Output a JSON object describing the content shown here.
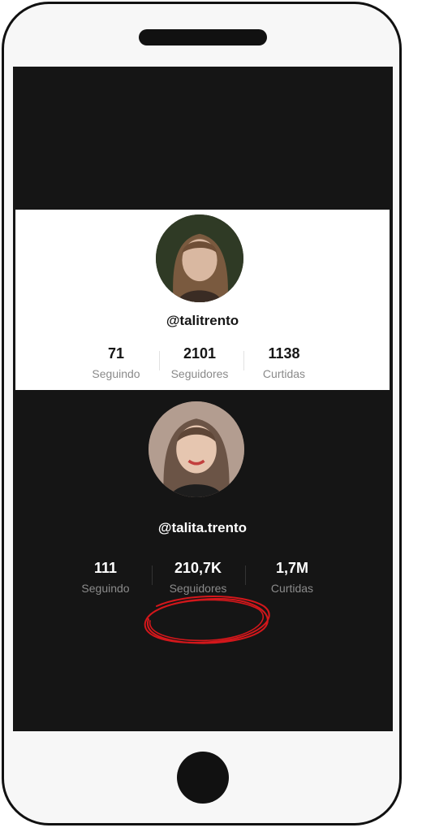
{
  "profiles": [
    {
      "handle": "@talitrento",
      "stats": [
        {
          "value": "71",
          "label": "Seguindo"
        },
        {
          "value": "2101",
          "label": "Seguidores"
        },
        {
          "value": "1138",
          "label": "Curtidas"
        }
      ]
    },
    {
      "handle": "@talita.trento",
      "stats": [
        {
          "value": "111",
          "label": "Seguindo"
        },
        {
          "value": "210,7K",
          "label": "Seguidores"
        },
        {
          "value": "1,7M",
          "label": "Curtidas"
        }
      ]
    }
  ],
  "colors": {
    "highlight": "#d3171b",
    "screen_bg": "#151515",
    "card_bg": "#ffffff"
  },
  "icons": [
    "profile-avatar",
    "red-hand-drawn-circle"
  ]
}
